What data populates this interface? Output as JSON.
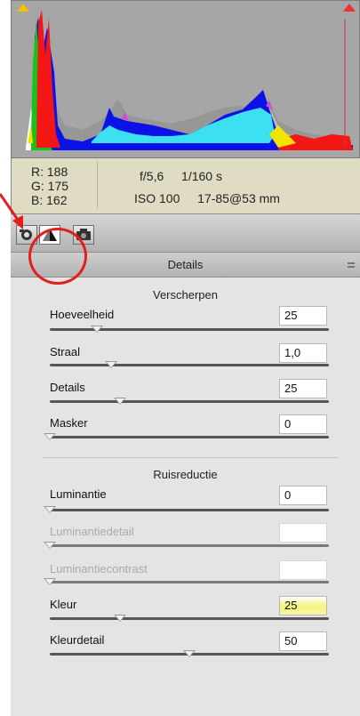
{
  "histogram": {
    "readout": {
      "r": "R:  188",
      "g": "G:  175",
      "b": "B:  162"
    },
    "aperture": "f/5,6",
    "shutter": "1/160 s",
    "iso": "ISO 100",
    "lens": "17-85@53 mm"
  },
  "tabs": [
    {
      "icon": "camera-icon",
      "selected": false
    },
    {
      "icon": "details-triangle-icon",
      "selected": true
    },
    {
      "icon": "camera-calibration-icon",
      "selected": false
    }
  ],
  "panel": {
    "title": "Details",
    "sharpen": {
      "title": "Verscherpen",
      "rows": [
        {
          "label": "Hoeveelheid",
          "value": "25",
          "level": 0.17
        },
        {
          "label": "Straal",
          "value": "1,0",
          "level": 0.22
        },
        {
          "label": "Details",
          "value": "25",
          "level": 0.25
        },
        {
          "label": "Masker",
          "value": "0",
          "level": 0.0
        }
      ]
    },
    "noise": {
      "title": "Ruisreductie",
      "rows": [
        {
          "label": "Luminantie",
          "value": "0",
          "level": 0.0,
          "disabled": false
        },
        {
          "label": "Luminantiedetail",
          "value": "",
          "level": 0.0,
          "disabled": true
        },
        {
          "label": "Luminantiecontrast",
          "value": "",
          "level": 0.0,
          "disabled": true
        },
        {
          "label": "Kleur",
          "value": "25",
          "level": 0.25,
          "disabled": false,
          "highlighted": true
        },
        {
          "label": "Kleurdetail",
          "value": "50",
          "level": 0.5,
          "disabled": false
        }
      ]
    }
  },
  "colors": {
    "annotation": "#e0201b",
    "highlight": "#f4f47a"
  }
}
